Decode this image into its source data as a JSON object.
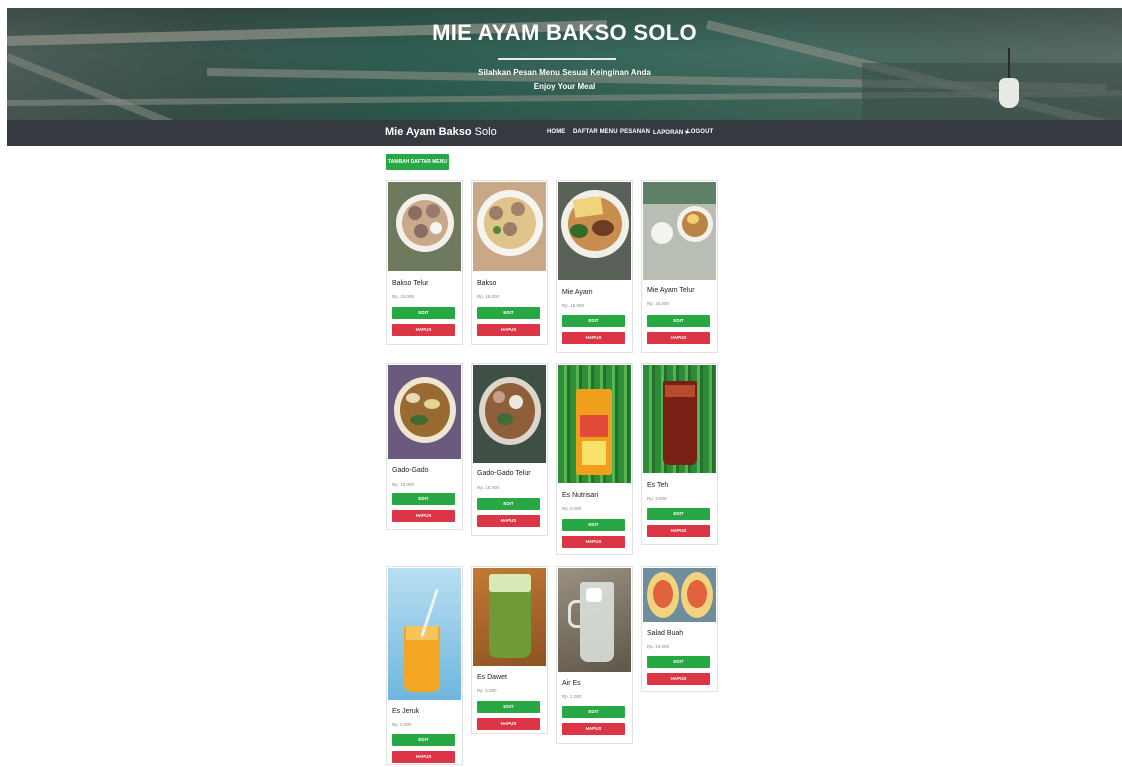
{
  "hero": {
    "title": "MIE AYAM BAKSO SOLO",
    "subtitle": "Silahkan Pesan Menu Sesuai Keinginan Anda",
    "subtitle2": "Enjoy Your Meal"
  },
  "navbar": {
    "brand_bold": "Mie Ayam Bakso",
    "brand_rest": "Solo",
    "items": [
      "HOME",
      "DAFTAR MENU",
      "PESANAN",
      "LAPORAN ▾",
      "LOGOUT"
    ]
  },
  "actions": {
    "add_label": "TAMBAH DAFTAR MENU"
  },
  "button_labels": {
    "edit": "EDIT",
    "delete": "HAPUS"
  },
  "menu": [
    {
      "name": "Bakso Telur",
      "price": "Rp. 15.000"
    },
    {
      "name": "Bakso",
      "price": "Rp. 15.000"
    },
    {
      "name": "Mie Ayam",
      "price": "Rp. 15.000"
    },
    {
      "name": "Mie Ayam Telur",
      "price": "Rp. 16.000"
    },
    {
      "name": "Gado-Gado",
      "price": "Rp. 15.000"
    },
    {
      "name": "Gado-Gado Telur",
      "price": "Rp. 15.000"
    },
    {
      "name": "Es Nutrisari",
      "price": "Rp. 5.000"
    },
    {
      "name": "Es Teh",
      "price": "Rp. 3.000"
    },
    {
      "name": "Es Jeruk",
      "price": "Rp. 5.000"
    },
    {
      "name": "Es Dawet",
      "price": "Rp. 5.000"
    },
    {
      "name": "Air Es",
      "price": "Rp. 1.000"
    },
    {
      "name": "Salad Buah",
      "price": "Rp. 15.000"
    }
  ],
  "colors": {
    "edit": "#28a745",
    "delete": "#dc3545",
    "navbar": "#343a40"
  }
}
